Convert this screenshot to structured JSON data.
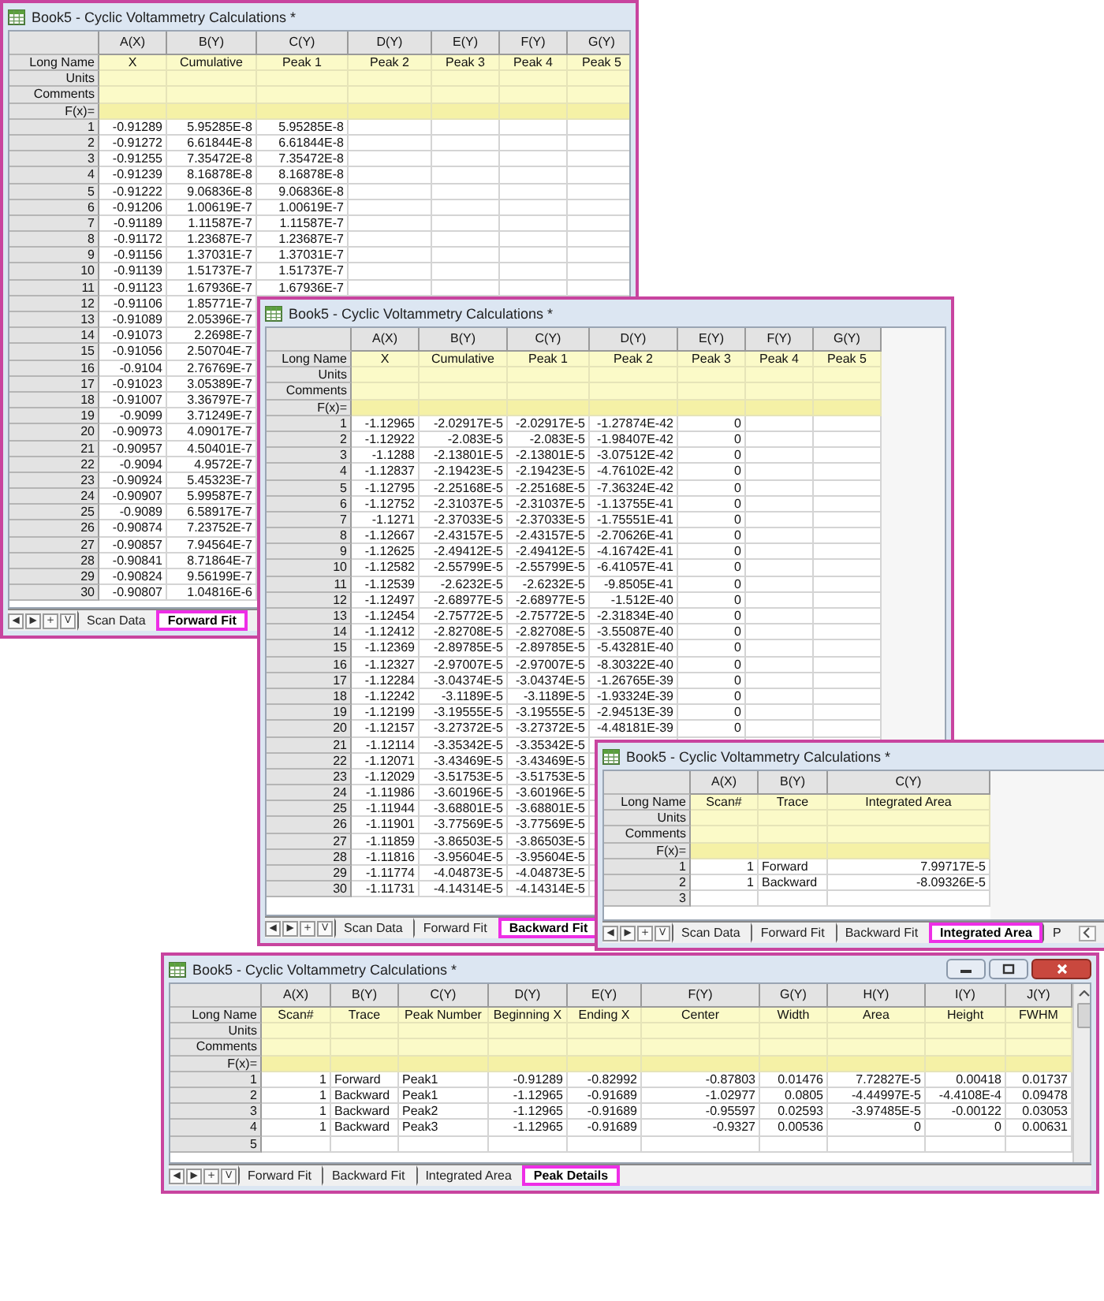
{
  "windows": [
    {
      "title": "Book5 - Cyclic Voltammetry Calculations *",
      "columns": [
        {
          "name": "A(X)",
          "long_name": "X"
        },
        {
          "name": "B(Y)",
          "long_name": "Cumulative"
        },
        {
          "name": "C(Y)",
          "long_name": "Peak 1"
        },
        {
          "name": "D(Y)",
          "long_name": "Peak 2"
        },
        {
          "name": "E(Y)",
          "long_name": "Peak 3"
        },
        {
          "name": "F(Y)",
          "long_name": "Peak 4"
        },
        {
          "name": "G(Y)",
          "long_name": "Peak 5"
        }
      ],
      "meta_rows": [
        "Long Name",
        "Units",
        "Comments",
        "F(x)="
      ],
      "rows": [
        {
          "number": "1",
          "cells": [
            "-0.91289",
            "5.95285E-8",
            "5.95285E-8"
          ]
        },
        {
          "number": "2",
          "cells": [
            "-0.91272",
            "6.61844E-8",
            "6.61844E-8"
          ]
        },
        {
          "number": "3",
          "cells": [
            "-0.91255",
            "7.35472E-8",
            "7.35472E-8"
          ]
        },
        {
          "number": "4",
          "cells": [
            "-0.91239",
            "8.16878E-8",
            "8.16878E-8"
          ]
        },
        {
          "number": "5",
          "cells": [
            "-0.91222",
            "9.06836E-8",
            "9.06836E-8"
          ]
        },
        {
          "number": "6",
          "cells": [
            "-0.91206",
            "1.00619E-7",
            "1.00619E-7"
          ]
        },
        {
          "number": "7",
          "cells": [
            "-0.91189",
            "1.11587E-7",
            "1.11587E-7"
          ]
        },
        {
          "number": "8",
          "cells": [
            "-0.91172",
            "1.23687E-7",
            "1.23687E-7"
          ]
        },
        {
          "number": "9",
          "cells": [
            "-0.91156",
            "1.37031E-7",
            "1.37031E-7"
          ]
        },
        {
          "number": "10",
          "cells": [
            "-0.91139",
            "1.51737E-7",
            "1.51737E-7"
          ]
        },
        {
          "number": "11",
          "cells": [
            "-0.91123",
            "1.67936E-7",
            "1.67936E-7"
          ]
        },
        {
          "number": "12",
          "cells": [
            "-0.91106",
            "1.85771E-7"
          ]
        },
        {
          "number": "13",
          "cells": [
            "-0.91089",
            "2.05396E-7"
          ]
        },
        {
          "number": "14",
          "cells": [
            "-0.91073",
            "2.2698E-7"
          ]
        },
        {
          "number": "15",
          "cells": [
            "-0.91056",
            "2.50704E-7"
          ]
        },
        {
          "number": "16",
          "cells": [
            "-0.9104",
            "2.76769E-7"
          ]
        },
        {
          "number": "17",
          "cells": [
            "-0.91023",
            "3.05389E-7"
          ]
        },
        {
          "number": "18",
          "cells": [
            "-0.91007",
            "3.36797E-7"
          ]
        },
        {
          "number": "19",
          "cells": [
            "-0.9099",
            "3.71249E-7"
          ]
        },
        {
          "number": "20",
          "cells": [
            "-0.90973",
            "4.09017E-7"
          ]
        },
        {
          "number": "21",
          "cells": [
            "-0.90957",
            "4.50401E-7"
          ]
        },
        {
          "number": "22",
          "cells": [
            "-0.9094",
            "4.9572E-7"
          ]
        },
        {
          "number": "23",
          "cells": [
            "-0.90924",
            "5.45323E-7"
          ]
        },
        {
          "number": "24",
          "cells": [
            "-0.90907",
            "5.99587E-7"
          ]
        },
        {
          "number": "25",
          "cells": [
            "-0.9089",
            "6.58917E-7"
          ]
        },
        {
          "number": "26",
          "cells": [
            "-0.90874",
            "7.23752E-7"
          ]
        },
        {
          "number": "27",
          "cells": [
            "-0.90857",
            "7.94564E-7"
          ]
        },
        {
          "number": "28",
          "cells": [
            "-0.90841",
            "8.71864E-7"
          ]
        },
        {
          "number": "29",
          "cells": [
            "-0.90824",
            "9.56199E-7"
          ]
        },
        {
          "number": "30",
          "cells": [
            "-0.90807",
            "1.04816E-6"
          ]
        }
      ],
      "nav_buttons": [
        "◀",
        "▶",
        "+",
        "V"
      ],
      "tabs": [
        {
          "label": "Scan Data",
          "selected": false
        },
        {
          "label": "Forward Fit",
          "selected": true
        }
      ]
    },
    {
      "title": "Book5 - Cyclic Voltammetry Calculations *",
      "columns": [
        {
          "name": "A(X)",
          "long_name": "X"
        },
        {
          "name": "B(Y)",
          "long_name": "Cumulative"
        },
        {
          "name": "C(Y)",
          "long_name": "Peak 1"
        },
        {
          "name": "D(Y)",
          "long_name": "Peak 2"
        },
        {
          "name": "E(Y)",
          "long_name": "Peak 3"
        },
        {
          "name": "F(Y)",
          "long_name": "Peak 4"
        },
        {
          "name": "G(Y)",
          "long_name": "Peak 5"
        }
      ],
      "meta_rows": [
        "Long Name",
        "Units",
        "Comments",
        "F(x)="
      ],
      "rows": [
        {
          "number": "1",
          "cells": [
            "-1.12965",
            "-2.02917E-5",
            "-2.02917E-5",
            "-1.27874E-42",
            "0"
          ]
        },
        {
          "number": "2",
          "cells": [
            "-1.12922",
            "-2.083E-5",
            "-2.083E-5",
            "-1.98407E-42",
            "0"
          ]
        },
        {
          "number": "3",
          "cells": [
            "-1.1288",
            "-2.13801E-5",
            "-2.13801E-5",
            "-3.07512E-42",
            "0"
          ]
        },
        {
          "number": "4",
          "cells": [
            "-1.12837",
            "-2.19423E-5",
            "-2.19423E-5",
            "-4.76102E-42",
            "0"
          ]
        },
        {
          "number": "5",
          "cells": [
            "-1.12795",
            "-2.25168E-5",
            "-2.25168E-5",
            "-7.36324E-42",
            "0"
          ]
        },
        {
          "number": "6",
          "cells": [
            "-1.12752",
            "-2.31037E-5",
            "-2.31037E-5",
            "-1.13755E-41",
            "0"
          ]
        },
        {
          "number": "7",
          "cells": [
            "-1.1271",
            "-2.37033E-5",
            "-2.37033E-5",
            "-1.75551E-41",
            "0"
          ]
        },
        {
          "number": "8",
          "cells": [
            "-1.12667",
            "-2.43157E-5",
            "-2.43157E-5",
            "-2.70626E-41",
            "0"
          ]
        },
        {
          "number": "9",
          "cells": [
            "-1.12625",
            "-2.49412E-5",
            "-2.49412E-5",
            "-4.16742E-41",
            "0"
          ]
        },
        {
          "number": "10",
          "cells": [
            "-1.12582",
            "-2.55799E-5",
            "-2.55799E-5",
            "-6.41057E-41",
            "0"
          ]
        },
        {
          "number": "11",
          "cells": [
            "-1.12539",
            "-2.6232E-5",
            "-2.6232E-5",
            "-9.8505E-41",
            "0"
          ]
        },
        {
          "number": "12",
          "cells": [
            "-1.12497",
            "-2.68977E-5",
            "-2.68977E-5",
            "-1.512E-40",
            "0"
          ]
        },
        {
          "number": "13",
          "cells": [
            "-1.12454",
            "-2.75772E-5",
            "-2.75772E-5",
            "-2.31834E-40",
            "0"
          ]
        },
        {
          "number": "14",
          "cells": [
            "-1.12412",
            "-2.82708E-5",
            "-2.82708E-5",
            "-3.55087E-40",
            "0"
          ]
        },
        {
          "number": "15",
          "cells": [
            "-1.12369",
            "-2.89785E-5",
            "-2.89785E-5",
            "-5.43281E-40",
            "0"
          ]
        },
        {
          "number": "16",
          "cells": [
            "-1.12327",
            "-2.97007E-5",
            "-2.97007E-5",
            "-8.30322E-40",
            "0"
          ]
        },
        {
          "number": "17",
          "cells": [
            "-1.12284",
            "-3.04374E-5",
            "-3.04374E-5",
            "-1.26765E-39",
            "0"
          ]
        },
        {
          "number": "18",
          "cells": [
            "-1.12242",
            "-3.1189E-5",
            "-3.1189E-5",
            "-1.93324E-39",
            "0"
          ]
        },
        {
          "number": "19",
          "cells": [
            "-1.12199",
            "-3.19555E-5",
            "-3.19555E-5",
            "-2.94513E-39",
            "0"
          ]
        },
        {
          "number": "20",
          "cells": [
            "-1.12157",
            "-3.27372E-5",
            "-3.27372E-5",
            "-4.48181E-39",
            "0"
          ]
        },
        {
          "number": "21",
          "cells": [
            "-1.12114",
            "-3.35342E-5",
            "-3.35342E-5"
          ]
        },
        {
          "number": "22",
          "cells": [
            "-1.12071",
            "-3.43469E-5",
            "-3.43469E-5"
          ]
        },
        {
          "number": "23",
          "cells": [
            "-1.12029",
            "-3.51753E-5",
            "-3.51753E-5"
          ]
        },
        {
          "number": "24",
          "cells": [
            "-1.11986",
            "-3.60196E-5",
            "-3.60196E-5"
          ]
        },
        {
          "number": "25",
          "cells": [
            "-1.11944",
            "-3.68801E-5",
            "-3.68801E-5"
          ]
        },
        {
          "number": "26",
          "cells": [
            "-1.11901",
            "-3.77569E-5",
            "-3.77569E-5"
          ]
        },
        {
          "number": "27",
          "cells": [
            "-1.11859",
            "-3.86503E-5",
            "-3.86503E-5"
          ]
        },
        {
          "number": "28",
          "cells": [
            "-1.11816",
            "-3.95604E-5",
            "-3.95604E-5"
          ]
        },
        {
          "number": "29",
          "cells": [
            "-1.11774",
            "-4.04873E-5",
            "-4.04873E-5"
          ]
        },
        {
          "number": "30",
          "cells": [
            "-1.11731",
            "-4.14314E-5",
            "-4.14314E-5"
          ]
        }
      ],
      "nav_buttons": [
        "◀",
        "▶",
        "+",
        "V"
      ],
      "tabs": [
        {
          "label": "Scan Data",
          "selected": false
        },
        {
          "label": "Forward Fit",
          "selected": false
        },
        {
          "label": "Backward Fit",
          "selected": true
        }
      ]
    },
    {
      "title": "Book5 - Cyclic Voltammetry Calculations *",
      "columns": [
        {
          "name": "A(X)",
          "long_name": "Scan#"
        },
        {
          "name": "B(Y)",
          "long_name": "Trace"
        },
        {
          "name": "C(Y)",
          "long_name": "Integrated Area"
        }
      ],
      "meta_rows": [
        "Long Name",
        "Units",
        "Comments",
        "F(x)="
      ],
      "rows": [
        {
          "number": "1",
          "cells": [
            "1",
            "Forward",
            "7.99717E-5"
          ]
        },
        {
          "number": "2",
          "cells": [
            "1",
            "Backward",
            "-8.09326E-5"
          ]
        },
        {
          "number": "3",
          "cells": []
        }
      ],
      "nav_buttons": [
        "◀",
        "▶",
        "+",
        "V"
      ],
      "tabs": [
        {
          "label": "Scan Data",
          "selected": false
        },
        {
          "label": "Forward Fit",
          "selected": false
        },
        {
          "label": "Backward Fit",
          "selected": false
        },
        {
          "label": "Integrated Area",
          "selected": true
        },
        {
          "label": "P",
          "selected": false
        }
      ]
    },
    {
      "title": "Book5 - Cyclic Voltammetry Calculations *",
      "columns": [
        {
          "name": "A(X)",
          "long_name": "Scan#"
        },
        {
          "name": "B(Y)",
          "long_name": "Trace"
        },
        {
          "name": "C(Y)",
          "long_name": "Peak Number"
        },
        {
          "name": "D(Y)",
          "long_name": "Beginning X"
        },
        {
          "name": "E(Y)",
          "long_name": "Ending X"
        },
        {
          "name": "F(Y)",
          "long_name": "Center"
        },
        {
          "name": "G(Y)",
          "long_name": "Width"
        },
        {
          "name": "H(Y)",
          "long_name": "Area"
        },
        {
          "name": "I(Y)",
          "long_name": "Height"
        },
        {
          "name": "J(Y)",
          "long_name": "FWHM"
        }
      ],
      "meta_rows": [
        "Long Name",
        "Units",
        "Comments",
        "F(x)="
      ],
      "rows": [
        {
          "number": "1",
          "cells": [
            "1",
            "Forward",
            "Peak1",
            "-0.91289",
            "-0.82992",
            "-0.87803",
            "0.01476",
            "7.72827E-5",
            "0.00418",
            "0.01737"
          ]
        },
        {
          "number": "2",
          "cells": [
            "1",
            "Backward",
            "Peak1",
            "-1.12965",
            "-0.91689",
            "-1.02977",
            "0.0805",
            "-4.44997E-5",
            "-4.4108E-4",
            "0.09478"
          ]
        },
        {
          "number": "3",
          "cells": [
            "1",
            "Backward",
            "Peak2",
            "-1.12965",
            "-0.91689",
            "-0.95597",
            "0.02593",
            "-3.97485E-5",
            "-0.00122",
            "0.03053"
          ]
        },
        {
          "number": "4",
          "cells": [
            "1",
            "Backward",
            "Peak3",
            "-1.12965",
            "-0.91689",
            "-0.9327",
            "0.00536",
            "0",
            "0",
            "0.00631"
          ]
        },
        {
          "number": "5",
          "cells": []
        }
      ],
      "nav_buttons": [
        "◀",
        "▶",
        "+",
        "V"
      ],
      "tabs": [
        {
          "label": "Forward Fit",
          "selected": false
        },
        {
          "label": "Backward Fit",
          "selected": false
        },
        {
          "label": "Integrated Area",
          "selected": false
        },
        {
          "label": "Peak Details",
          "selected": true
        }
      ]
    }
  ]
}
